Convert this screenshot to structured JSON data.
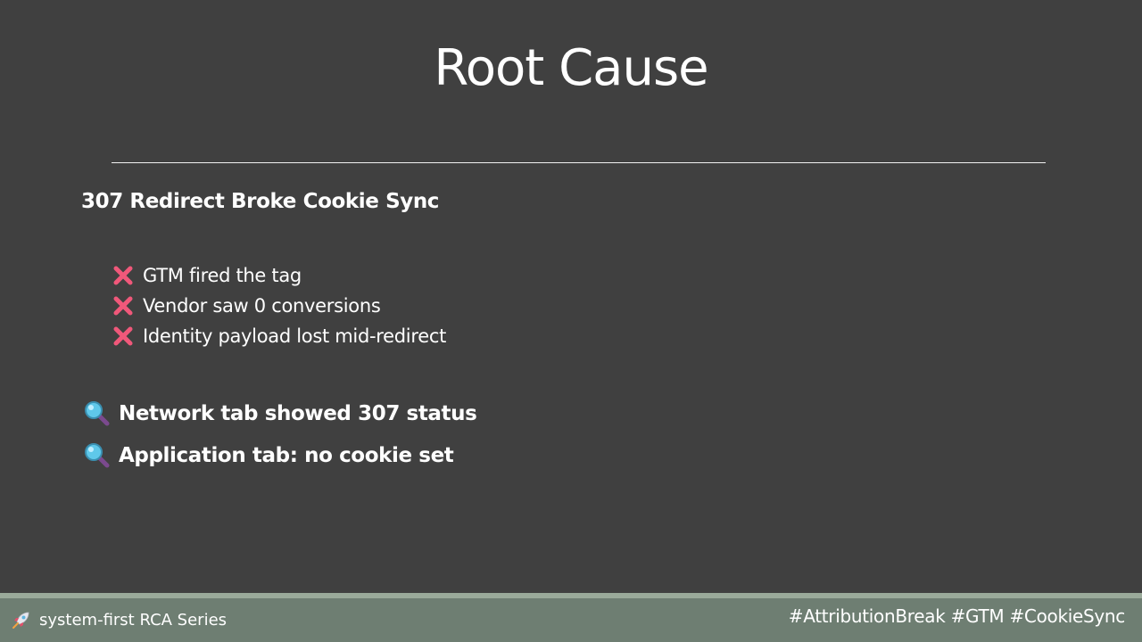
{
  "slide": {
    "title": "Root Cause",
    "subtitle": "307 Redirect Broke Cookie Sync",
    "bullets": [
      {
        "icon": "cross-mark-icon",
        "text": "GTM fired the tag"
      },
      {
        "icon": "cross-mark-icon",
        "text": "Vendor saw 0 conversions"
      },
      {
        "icon": "cross-mark-icon",
        "text": "Identity payload lost mid-redirect"
      }
    ],
    "findings": [
      {
        "icon": "magnifying-glass-icon",
        "text": "Network tab showed 307 status"
      },
      {
        "icon": "magnifying-glass-icon",
        "text": "Application tab: no cookie set"
      }
    ]
  },
  "footer": {
    "left_icon": "rocket-icon",
    "left_text": "system-first RCA Series",
    "right_text": "#AttributionBreak #GTM #CookieSync"
  },
  "colors": {
    "background": "#404040",
    "footer": "#6e7e72",
    "footer_stripe": "#9aaa9a",
    "cross": "#f0587a",
    "text": "#ffffff"
  }
}
